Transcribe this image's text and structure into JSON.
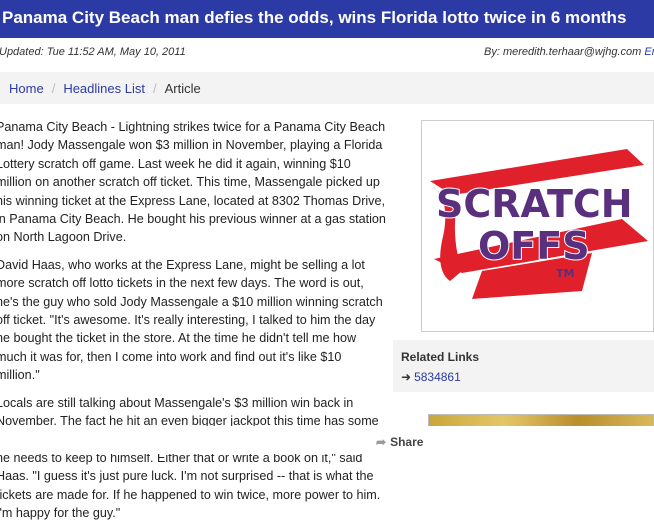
{
  "headline": "Panama City Beach man defies the odds, wins Florida lotto twice in 6 months",
  "meta": {
    "updated": "Updated: Tue 11:52 AM, May 10, 2011",
    "byline_prefix": "By: meredith.terhaar@wjhg.com",
    "email_link": "Em"
  },
  "breadcrumb": {
    "home": "Home",
    "headlines": "Headlines List",
    "current": "Article",
    "separator": "/"
  },
  "article": {
    "paragraphs": [
      "Panama City Beach - Lightning strikes twice for a Panama City Beach man! Jody Massengale won $3 million in November, playing a Florida Lottery scratch off game. Last week he did it again, winning $10 million on another scratch off ticket. This time, Massengale picked up his winning ticket at the Express Lane, located at 8302 Thomas Drive, in Panama City Beach. He bought his previous winner at a gas station on North Lagoon Drive.",
      "David Haas, who works at the Express Lane, might be selling a lot more scratch off lotto tickets in the next few days. The word is out, he's the guy who sold Jody Massengale a $10 million winning scratch off ticket. \"It's awesome. It's really interesting, I talked to him the day he bought the ticket in the store. At the time he didn't tell me how much it was for, then I come into work and find out it's like $10 million.\"",
      "Locals are still talking about Massengale's $3 million win back in November. The fact he hit an even bigger jackpot this time has some wondering if he's got some kind of system. \"If he does, it's something he needs to keep to himself. Either that or write a book on it,\" said Haas. \"I guess it's just pure luck. I'm not surprised -- that is what the tickets are made for. If he happened to win twice, more power to him. I'm happy for the guy.\""
    ]
  },
  "image": {
    "logo_line1": "SCRATCH",
    "logo_line2": "OFFS",
    "logo_tm": "TM"
  },
  "related": {
    "title": "Related Links",
    "arrow_icon": "arrow-right-icon",
    "link": "5834861"
  },
  "share": {
    "label": "Share",
    "icon": "share-icon"
  },
  "colors": {
    "brand_blue": "#2c3aa5",
    "logo_purple": "#5a2f7e",
    "logo_red": "#e0202a"
  }
}
